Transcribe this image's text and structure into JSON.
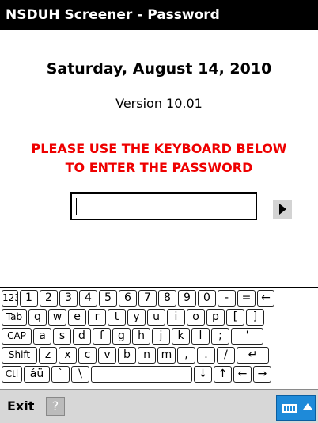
{
  "window": {
    "title": "NSDUH Screener - Password"
  },
  "main": {
    "date": "Saturday, August 14, 2010",
    "version": "Version 10.01",
    "instruction_line1": "PLEASE USE THE KEYBOARD BELOW",
    "instruction_line2": "TO ENTER THE PASSWORD",
    "password_value": ""
  },
  "keyboard": {
    "row1": [
      "123",
      "1",
      "2",
      "3",
      "4",
      "5",
      "6",
      "7",
      "8",
      "9",
      "0",
      "-",
      "=",
      "←"
    ],
    "row2": [
      "Tab",
      "q",
      "w",
      "e",
      "r",
      "t",
      "y",
      "u",
      "i",
      "o",
      "p",
      "[",
      "]"
    ],
    "row3": [
      "CAP",
      "a",
      "s",
      "d",
      "f",
      "g",
      "h",
      "j",
      "k",
      "l",
      ";",
      "'"
    ],
    "row4": [
      "Shift",
      "z",
      "x",
      "c",
      "v",
      "b",
      "n",
      "m",
      ",",
      ".",
      "/",
      "↵"
    ],
    "row5": [
      "Ctl",
      "áü",
      "`",
      "\\",
      "",
      "↓",
      "↑",
      "←",
      "→"
    ]
  },
  "bottombar": {
    "exit_label": "Exit",
    "help_glyph": "?"
  },
  "icons": {
    "go": "play-arrow-icon",
    "help": "help-icon",
    "sip": "keyboard-icon"
  },
  "colors": {
    "titlebar": "#000000",
    "instruction": "#ee0000",
    "sip": "#1e8ad9"
  }
}
